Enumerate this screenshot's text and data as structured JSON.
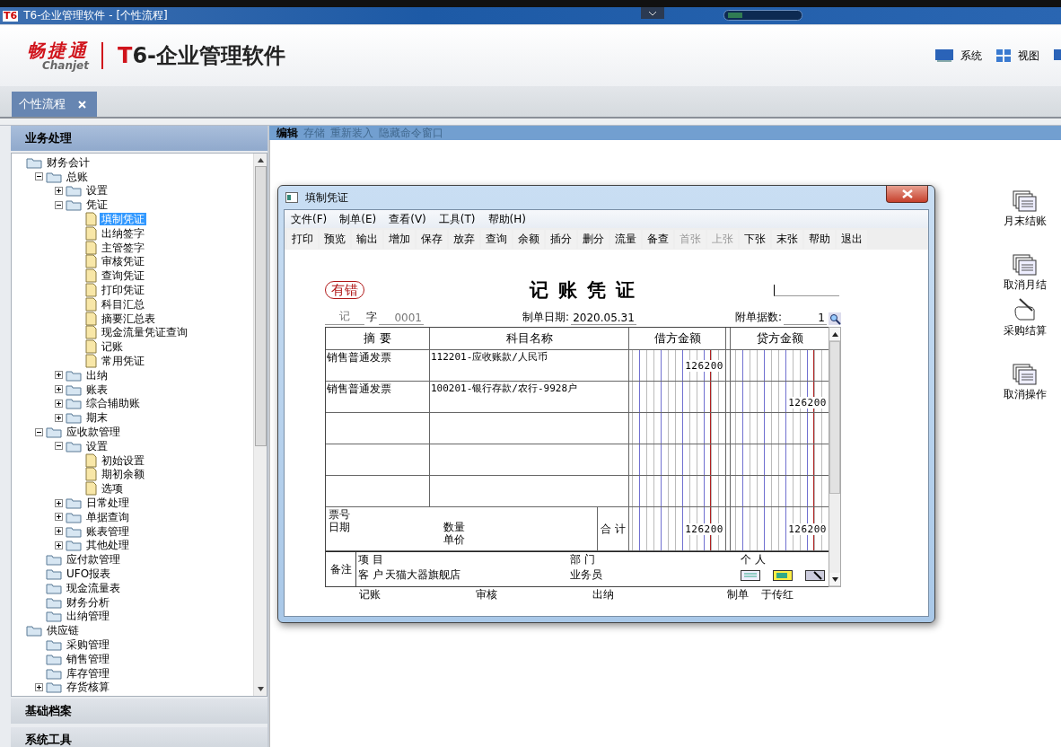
{
  "title_bar": {
    "app_icon": "T6",
    "title": "T6-企业管理软件 - [个性流程]"
  },
  "header": {
    "brand": "畅捷通",
    "brand_latin": "Chanjet",
    "product_mark": "T",
    "product_name": "6-企业管理软件",
    "menus": [
      {
        "label": "系统",
        "kind": "monitor"
      },
      {
        "label": "视图",
        "kind": "grid"
      }
    ]
  },
  "tabs": [
    {
      "label": "个性流程",
      "selected": true
    }
  ],
  "sidebar": {
    "sections": [
      {
        "label": "业务处理",
        "expanded": true
      },
      {
        "label": "基础档案",
        "expanded": false
      },
      {
        "label": "系统工具",
        "expanded": false
      }
    ],
    "tree": [
      {
        "label": "财务会计",
        "kind": "root",
        "selected": false,
        "children": [
          {
            "label": "总账",
            "kind": "branch",
            "expanded": true,
            "selected": false,
            "children": [
              {
                "label": "设置",
                "kind": "branch",
                "expanded": false,
                "selected": false
              },
              {
                "label": "凭证",
                "kind": "branch",
                "expanded": true,
                "selected": false,
                "children": [
                  {
                    "label": "填制凭证",
                    "kind": "doc",
                    "selected": true
                  },
                  {
                    "label": "出纳签字",
                    "kind": "doc",
                    "selected": false
                  },
                  {
                    "label": "主管签字",
                    "kind": "doc",
                    "selected": false
                  },
                  {
                    "label": "审核凭证",
                    "kind": "doc",
                    "selected": false
                  },
                  {
                    "label": "查询凭证",
                    "kind": "doc",
                    "selected": false
                  },
                  {
                    "label": "打印凭证",
                    "kind": "doc",
                    "selected": false
                  },
                  {
                    "label": "科目汇总",
                    "kind": "doc",
                    "selected": false
                  },
                  {
                    "label": "摘要汇总表",
                    "kind": "doc",
                    "selected": false
                  },
                  {
                    "label": "现金流量凭证查询",
                    "kind": "doc",
                    "selected": false
                  },
                  {
                    "label": "记账",
                    "kind": "doc",
                    "selected": false
                  },
                  {
                    "label": "常用凭证",
                    "kind": "doc",
                    "selected": false
                  }
                ]
              },
              {
                "label": "出纳",
                "kind": "branch",
                "expanded": false,
                "selected": false
              },
              {
                "label": "账表",
                "kind": "branch",
                "expanded": false,
                "selected": false
              },
              {
                "label": "综合辅助账",
                "kind": "branch",
                "expanded": false,
                "selected": false
              },
              {
                "label": "期末",
                "kind": "branch",
                "expanded": false,
                "selected": false
              }
            ]
          },
          {
            "label": "应收款管理",
            "kind": "branch",
            "expanded": true,
            "selected": false,
            "children": [
              {
                "label": "设置",
                "kind": "branch",
                "expanded": true,
                "selected": false,
                "children": [
                  {
                    "label": "初始设置",
                    "kind": "doc",
                    "selected": false
                  },
                  {
                    "label": "期初余额",
                    "kind": "doc",
                    "selected": false
                  },
                  {
                    "label": "选项",
                    "kind": "doc",
                    "selected": false
                  }
                ]
              },
              {
                "label": "日常处理",
                "kind": "branch",
                "expanded": false,
                "selected": false
              },
              {
                "label": "单据查询",
                "kind": "branch",
                "expanded": false,
                "selected": false
              },
              {
                "label": "账表管理",
                "kind": "branch",
                "expanded": false,
                "selected": false
              },
              {
                "label": "其他处理",
                "kind": "branch",
                "expanded": false,
                "selected": false
              }
            ]
          },
          {
            "label": "应付款管理",
            "kind": "folder",
            "selected": false
          },
          {
            "label": "UFO报表",
            "kind": "folder",
            "selected": false
          },
          {
            "label": "现金流量表",
            "kind": "folder",
            "selected": false
          },
          {
            "label": "财务分析",
            "kind": "folder",
            "selected": false
          },
          {
            "label": "出纳管理",
            "kind": "folder",
            "selected": false
          }
        ]
      },
      {
        "label": "供应链",
        "kind": "root",
        "selected": false,
        "children": [
          {
            "label": "采购管理",
            "kind": "folder",
            "selected": false
          },
          {
            "label": "销售管理",
            "kind": "folder",
            "selected": false
          },
          {
            "label": "库存管理",
            "kind": "folder",
            "selected": false
          },
          {
            "label": "存货核算",
            "kind": "branch",
            "expanded": false,
            "selected": false
          }
        ]
      }
    ]
  },
  "command_bar": [
    {
      "label": "编辑",
      "disabled": false
    },
    {
      "label": "存储",
      "disabled": true
    },
    {
      "label": "重新装入",
      "disabled": true
    },
    {
      "label": "隐藏命令窗口",
      "disabled": true
    }
  ],
  "desktop_actions": [
    {
      "label": "月末结账",
      "kind": "pages"
    },
    {
      "label": "取消月结",
      "kind": "pages"
    },
    {
      "label": "采购结算",
      "kind": "hand"
    },
    {
      "label": "取消操作",
      "kind": "pages"
    }
  ],
  "dialog": {
    "title": "填制凭证",
    "menus": [
      "文件(F)",
      "制单(E)",
      "查看(V)",
      "工具(T)",
      "帮助(H)"
    ],
    "toolbar": [
      {
        "label": "打印",
        "disabled": false
      },
      {
        "label": "预览",
        "disabled": false
      },
      {
        "label": "输出",
        "disabled": false
      },
      {
        "label": "增加",
        "disabled": false
      },
      {
        "label": "保存",
        "disabled": false
      },
      {
        "label": "放弃",
        "disabled": false
      },
      {
        "label": "查询",
        "disabled": false
      },
      {
        "label": "余额",
        "disabled": false
      },
      {
        "label": "插分",
        "disabled": false
      },
      {
        "label": "删分",
        "disabled": false
      },
      {
        "label": "流量",
        "disabled": false
      },
      {
        "label": "备查",
        "disabled": false
      },
      {
        "label": "首张",
        "disabled": true
      },
      {
        "label": "上张",
        "disabled": true
      },
      {
        "label": "下张",
        "disabled": false
      },
      {
        "label": "末张",
        "disabled": false
      },
      {
        "label": "帮助",
        "disabled": false
      },
      {
        "label": "退出",
        "disabled": false
      }
    ],
    "voucher": {
      "error_stamp": "有错",
      "title": "记 账 凭 证",
      "type": "记",
      "type_suffix": "字",
      "number": "0001",
      "date_label": "制单日期:",
      "date": "2020.05.31",
      "attachments_label": "附单据数:",
      "attachments": "1",
      "columns": [
        "摘 要",
        "科目名称",
        "借方金额",
        "贷方金额"
      ],
      "rows": [
        {
          "summary": "销售普通发票",
          "account": "112201-应收账款/人民币",
          "debit": "126200"
        },
        {
          "summary": "销售普通发票",
          "account": "100201-银行存款/农行-9928户",
          "credit": "126200"
        }
      ],
      "totals": {
        "bill_no_label": "票号",
        "date_label": "日期",
        "quantity_label": "数量",
        "price_label": "单价",
        "total_label": "合 计",
        "debit": "126200",
        "credit": "126200"
      },
      "remarks": {
        "label": "备注",
        "project_label": "项 目",
        "department_label": "部 门",
        "person_label": "个 人",
        "customer_label": "客 户",
        "customer": "天猫大器旗舰店",
        "salesman_label": "业务员"
      },
      "signatures": [
        {
          "label": "记账"
        },
        {
          "label": "审核"
        },
        {
          "label": "出纳"
        },
        {
          "label": "制单",
          "name": "于传红"
        }
      ]
    }
  }
}
